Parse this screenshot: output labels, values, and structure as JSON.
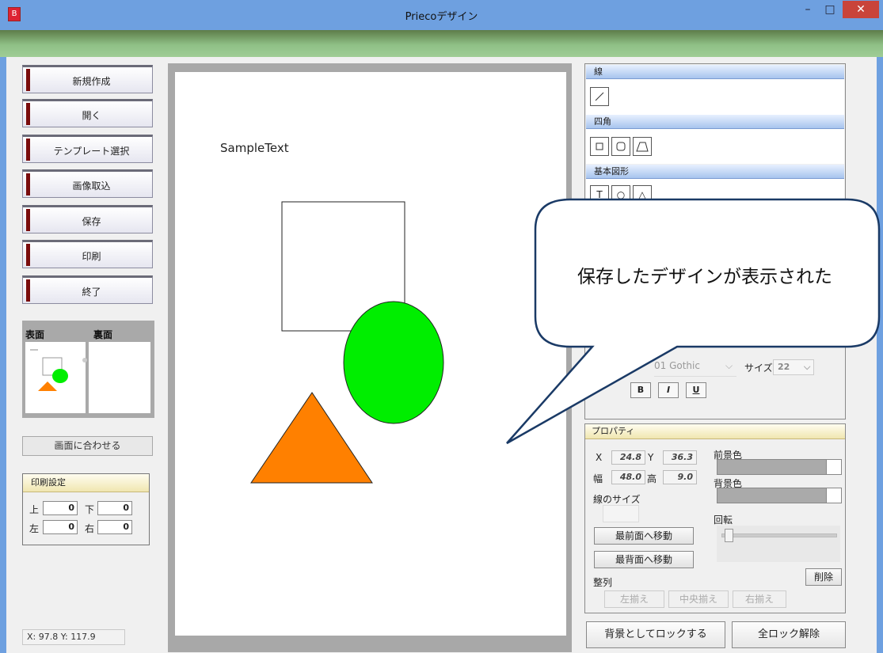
{
  "window": {
    "title": "Priecoデザイン",
    "app_icon": "B"
  },
  "controls": {
    "minimize": "–",
    "maximize": "□",
    "close": "✕"
  },
  "menu": [
    {
      "label": "新規作成"
    },
    {
      "label": "開く"
    },
    {
      "label": "テンプレート選択"
    },
    {
      "label": "画像取込"
    },
    {
      "label": "保存"
    },
    {
      "label": "印刷"
    },
    {
      "label": "終了"
    }
  ],
  "preview": {
    "front": "表面",
    "back": "裏面"
  },
  "fit_button": "画面に合わせる",
  "print_settings": {
    "title": "印刷設定",
    "top_label": "上",
    "top": "0",
    "bottom_label": "下",
    "bottom": "0",
    "left_label": "左",
    "left": "0",
    "right_label": "右",
    "right": "0"
  },
  "cursor_coords": "X: 97.8  Y: 117.9",
  "canvas": {
    "sample_text": "SampleText"
  },
  "colors": {
    "green": "#00ee00",
    "orange": "#ff8000",
    "accent": "#a7c4ee"
  },
  "tools": {
    "line_header": "線",
    "rect_header": "四角",
    "shape_header": "基本図形",
    "line_icon": "diagonal-line-icon",
    "rect_icons": [
      "square-icon",
      "rounded-square-icon",
      "trapezoid-icon"
    ],
    "shape_icons": [
      "text-icon",
      "circle-icon",
      "triangle-icon"
    ]
  },
  "font": {
    "name": "01 Gothic",
    "size_label": "サイズ",
    "size": "22",
    "bold": "B",
    "italic": "I",
    "underline": "U"
  },
  "properties": {
    "title": "プロパティ",
    "x_label": "X",
    "x": "24.8",
    "y_label": "Y",
    "y": "36.3",
    "w_label": "幅",
    "w": "48.0",
    "h_label": "高",
    "h": "9.0",
    "fg_label": "前景色",
    "bg_label": "背景色",
    "line_size_label": "線のサイズ",
    "rotate_label": "回転",
    "bring_front": "最前面へ移動",
    "send_back": "最背面へ移動",
    "delete": "削除",
    "align_label": "整列",
    "align_left": "左揃え",
    "align_center": "中央揃え",
    "align_right": "右揃え"
  },
  "bottom_buttons": {
    "lock_bg": "背景としてロックする",
    "unlock_all": "全ロック解除"
  },
  "callout": "保存したデザインが表示された"
}
